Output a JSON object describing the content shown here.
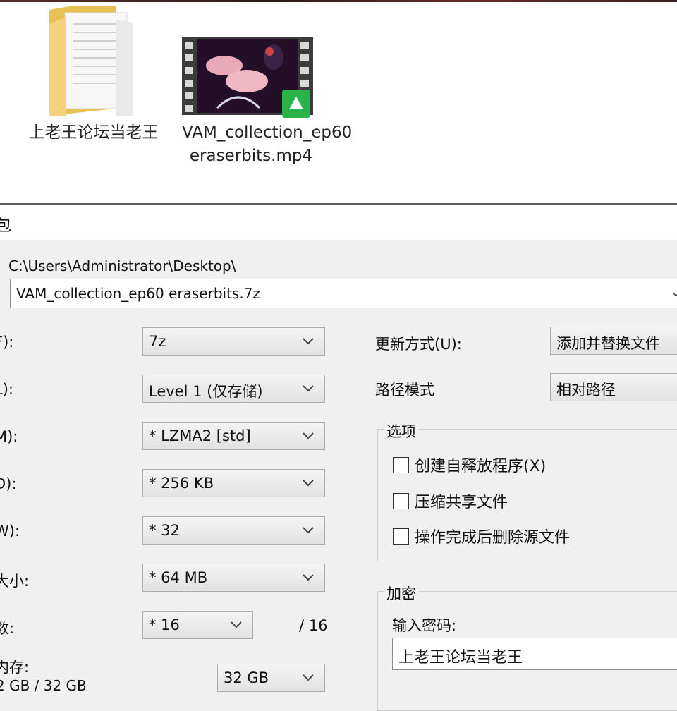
{
  "desktop": {
    "folder": {
      "label": "上老王论坛当老王",
      "icon": "folder-icon"
    },
    "video": {
      "label": "VAM_collection_ep60 eraserbits.mp4",
      "icon": "video-thumbnail"
    }
  },
  "window": {
    "title": "包"
  },
  "archive": {
    "path": "C:\\Users\\Administrator\\Desktop\\",
    "filename": "VAM_collection_ep60 eraserbits.7z"
  },
  "left_settings": [
    {
      "label": "F):",
      "value": "7z"
    },
    {
      "label": "L):",
      "value": "Level 1 (仅存储)"
    },
    {
      "label": "M):",
      "value": "* LZMA2 [std]"
    },
    {
      "label": "D):",
      "value": "* 256 KB"
    },
    {
      "label": "W):",
      "value": "* 32"
    },
    {
      "label": "大小:",
      "value": "* 64 MB"
    },
    {
      "label": "数:",
      "value": "* 16",
      "suffix": "/ 16"
    },
    {
      "label": "内存:",
      "sub": "2 GB / 32 GB",
      "value": "32 GB"
    }
  ],
  "right_settings": {
    "update_mode": {
      "label": "更新方式(U):",
      "value": "添加并替换文件"
    },
    "path_mode": {
      "label": "路径模式",
      "value": "相对路径"
    }
  },
  "options": {
    "title": "选项",
    "items": [
      {
        "label": "创建自释放程序(X)",
        "checked": false
      },
      {
        "label": "压缩共享文件",
        "checked": false
      },
      {
        "label": "操作完成后删除源文件",
        "checked": false
      }
    ]
  },
  "encryption": {
    "title": "加密",
    "password_label": "输入密码:",
    "password_value": "上老王论坛当老王"
  }
}
